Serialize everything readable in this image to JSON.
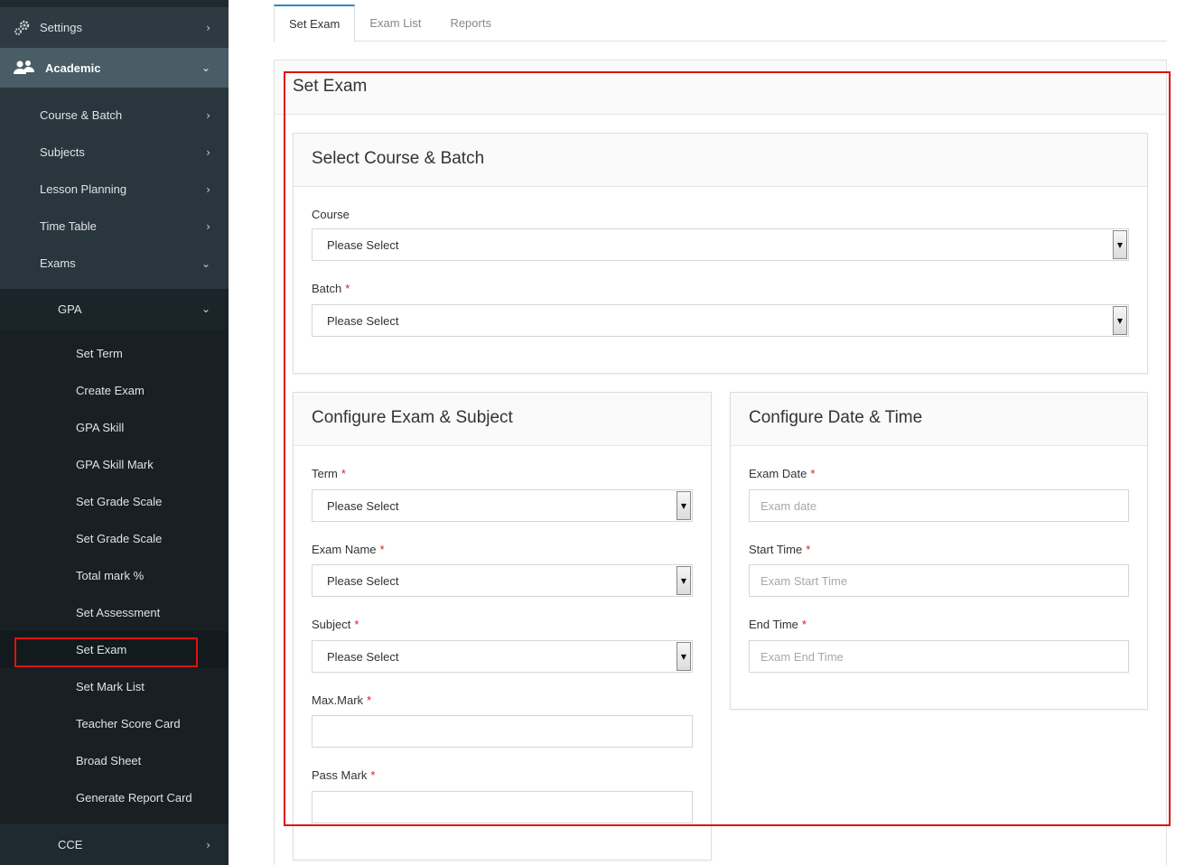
{
  "sidebar": {
    "settings": "Settings",
    "academic": "Academic",
    "level1": [
      "Course & Batch",
      "Subjects",
      "Lesson Planning",
      "Time Table",
      "Exams"
    ],
    "gpa": "GPA",
    "level3": [
      "Set Term",
      "Create Exam",
      "GPA Skill",
      "GPA Skill Mark",
      "Set Grade Scale",
      "Set Grade Scale",
      "Total mark %",
      "Set Assessment",
      "Set Exam",
      "Set Mark List",
      "Teacher Score Card",
      "Broad Sheet",
      "Generate Report Card"
    ],
    "cce": "CCE",
    "active_item": "Set Exam"
  },
  "tabs": [
    "Set Exam",
    "Exam List",
    "Reports"
  ],
  "main": {
    "title": "Set Exam",
    "course_batch": {
      "title": "Select Course & Batch",
      "course_label": "Course",
      "course_value": "Please Select",
      "batch_label": "Batch",
      "batch_value": "Please Select"
    },
    "exam_subject": {
      "title": "Configure Exam & Subject",
      "term_label": "Term",
      "term_value": "Please Select",
      "exam_name_label": "Exam Name",
      "exam_name_value": "Please Select",
      "subject_label": "Subject",
      "subject_value": "Please Select",
      "max_mark_label": "Max.Mark",
      "max_mark_value": "",
      "pass_mark_label": "Pass Mark",
      "pass_mark_value": ""
    },
    "date_time": {
      "title": "Configure Date & Time",
      "exam_date_label": "Exam Date",
      "exam_date_placeholder": "Exam date",
      "start_time_label": "Start Time",
      "start_time_placeholder": "Exam Start Time",
      "end_time_label": "End Time",
      "end_time_placeholder": "Exam End Time"
    },
    "required_mark": "*"
  },
  "colors": {
    "sidebar_bg": "#1f2a30",
    "academic_bg": "#4a5c66",
    "tab_accent": "#2a88c8",
    "required": "#d21f1f",
    "highlight": "#e01010"
  },
  "icons": {
    "settings": "gear-icon",
    "academic": "users-icon",
    "collapsed": "chevron-right-icon",
    "expanded": "chevron-down-icon",
    "select": "dropdown-arrow-icon"
  }
}
